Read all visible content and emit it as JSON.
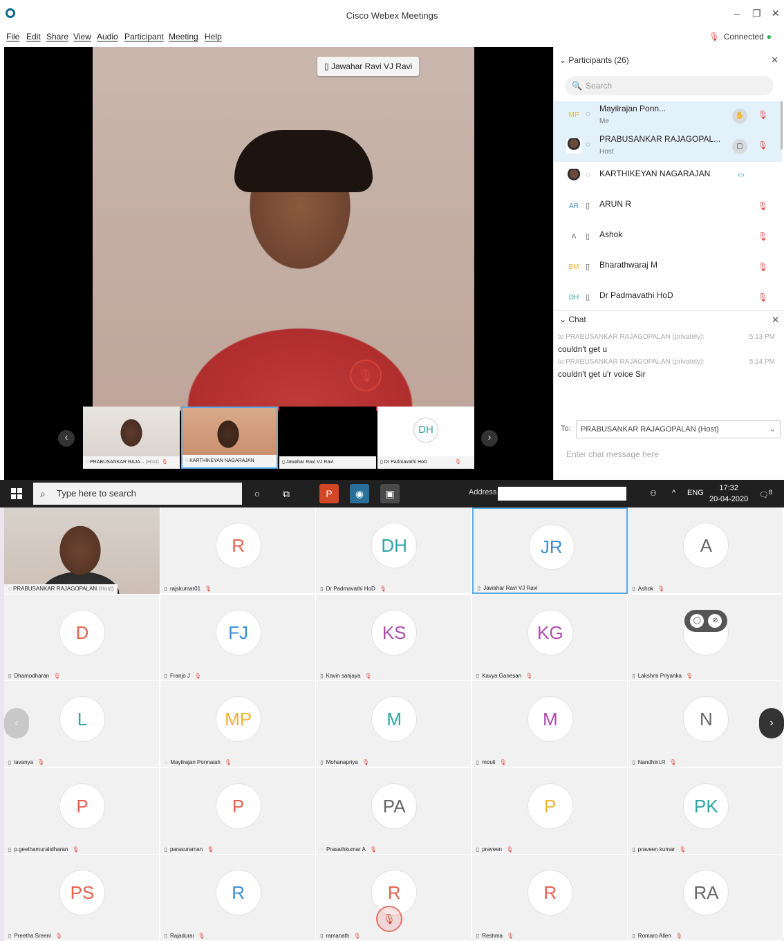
{
  "window": {
    "title": "Cisco Webex Meetings",
    "minimize": "–",
    "restore": "❐",
    "close": "✕"
  },
  "menu": [
    "File",
    "Edit",
    "Share",
    "View",
    "Audio",
    "Participant",
    "Meeting",
    "Help"
  ],
  "connection": {
    "status": "Connected",
    "status_color": "#27b24a"
  },
  "active_speaker": {
    "name": "Jawahar Ravi VJ Ravi"
  },
  "filmstrip": [
    {
      "name": "PRABUSANKAR RAJA...",
      "role": "(Host)",
      "muted": true
    },
    {
      "name": "KARTHIKEYAN NAGARAJAN",
      "muted": false
    },
    {
      "name": "Jawahar Ravi VJ Ravi",
      "muted": false
    },
    {
      "name": "Dr Padmavathi HoD",
      "initials": "DH",
      "muted": true
    }
  ],
  "participants_panel": {
    "header": "Participants (26)",
    "search_placeholder": "Search",
    "items": [
      {
        "initials": "MP",
        "name": "Mayilrajan Ponn...",
        "sub": "Me",
        "initials_color": "#f0b42d"
      },
      {
        "initials": "",
        "name": "PRABUSANKAR RAJAGOPAL...",
        "sub": "Host",
        "initials_color": "#333333"
      },
      {
        "initials": "",
        "name": "KARTHIKEYAN NAGARAJAN",
        "sub": "",
        "initials_color": "#333333"
      },
      {
        "initials": "AR",
        "name": "ARUN R",
        "sub": "",
        "initials_color": "#3a8fd8"
      },
      {
        "initials": "A",
        "name": "Ashok",
        "sub": "",
        "initials_color": "#777777"
      },
      {
        "initials": "BM",
        "name": "Bharathwaraj M",
        "sub": "",
        "initials_color": "#f0b42d"
      },
      {
        "initials": "DH",
        "name": "Dr Padmavathi HoD",
        "sub": "",
        "initials_color": "#2aa5a5"
      }
    ]
  },
  "chat": {
    "header": "Chat",
    "messages": [
      {
        "meta": "to PRABUSANKAR RAJAGOPALAN (privately):",
        "time": "5:13 PM",
        "text": "couldn't get u"
      },
      {
        "meta": "to PRABUSANKAR RAJAGOPALAN (privately):",
        "time": "5:14 PM",
        "text": "couldn't get u'r voice Sir"
      }
    ],
    "to_label": "To:",
    "to_value": "PRABUSANKAR RAJAGOPALAN (Host)",
    "input_placeholder": "Enter chat message here"
  },
  "taskbar": {
    "search_placeholder": "Type here to search",
    "address_label": "Address",
    "lang": "ENG",
    "time": "17:32",
    "date": "20-04-2020",
    "notifications": "8"
  },
  "grid": [
    {
      "name": "PRABUSANKAR RAJAGOPALAN",
      "role": "(Host)",
      "initials": "",
      "color": "#333333",
      "video": true
    },
    {
      "name": "rajskumar01",
      "initials": "R",
      "color": "#e8604c"
    },
    {
      "name": "Dr Padmavathi HoD",
      "initials": "DH",
      "color": "#2aa5a5"
    },
    {
      "name": "Jawahar Ravi VJ Ravi",
      "initials": "JR",
      "color": "#3a8fd8",
      "selected": true
    },
    {
      "name": "Ashok",
      "initials": "A",
      "color": "#666666"
    },
    {
      "name": "Dhamodharan",
      "initials": "D",
      "color": "#e8604c"
    },
    {
      "name": "Franjo J",
      "initials": "FJ",
      "color": "#3a8fd8"
    },
    {
      "name": "Kavin sanjaya",
      "initials": "KS",
      "color": "#b04cb0"
    },
    {
      "name": "Kavya Ganesan",
      "initials": "KG",
      "color": "#b04cb0"
    },
    {
      "name": "Lakshmi Priyanka",
      "initials": "",
      "color": "#666666",
      "control": true
    },
    {
      "name": "lavanya",
      "initials": "L",
      "color": "#2aa5a5"
    },
    {
      "name": "Mayilrajan Ponnaiah",
      "initials": "MP",
      "color": "#f0b42d"
    },
    {
      "name": "Mohanapriya",
      "initials": "M",
      "color": "#2aa5a5"
    },
    {
      "name": "mouli",
      "initials": "M",
      "color": "#b04cb0"
    },
    {
      "name": "Nandhini.R",
      "initials": "N",
      "color": "#666666"
    },
    {
      "name": "p.geethamuralidharan",
      "initials": "P",
      "color": "#e8604c"
    },
    {
      "name": "parasuraman",
      "initials": "P",
      "color": "#e8604c"
    },
    {
      "name": "Prasathkumar A",
      "initials": "PA",
      "color": "#666666"
    },
    {
      "name": "praveen",
      "initials": "P",
      "color": "#f0b42d"
    },
    {
      "name": "praveen kumar",
      "initials": "PK",
      "color": "#2aa5a5"
    },
    {
      "name": "Preetha Sreeni",
      "initials": "PS",
      "color": "#e8604c"
    },
    {
      "name": "Rajadurai",
      "initials": "R",
      "color": "#3a8fd8"
    },
    {
      "name": "ramanath",
      "initials": "R",
      "color": "#e8604c"
    },
    {
      "name": "Reshma",
      "initials": "R",
      "color": "#e8604c"
    },
    {
      "name": "Romaro Allen",
      "initials": "RA",
      "color": "#666666"
    }
  ]
}
